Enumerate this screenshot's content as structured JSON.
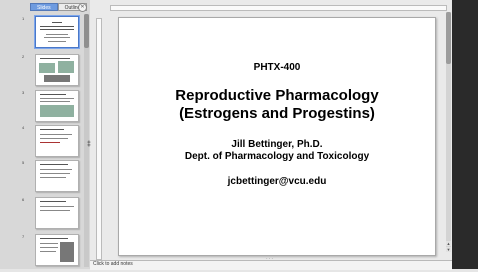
{
  "sidebar": {
    "tabs": [
      {
        "label": "Slides",
        "active": true
      },
      {
        "label": "Outline",
        "active": false
      }
    ],
    "close_icon": "close-icon",
    "slides": [
      {
        "number": "1",
        "selected": true
      },
      {
        "number": "2",
        "selected": false
      },
      {
        "number": "3",
        "selected": false
      },
      {
        "number": "4",
        "selected": false
      },
      {
        "number": "5",
        "selected": false
      },
      {
        "number": "6",
        "selected": false
      },
      {
        "number": "7",
        "selected": false
      }
    ]
  },
  "slide": {
    "course_code": "PHTX-400",
    "title_line1": "Reproductive Pharmacology",
    "title_line2": "(Estrogens and Progestins)",
    "presenter": "Jill Bettinger, Ph.D.",
    "department": "Dept. of Pharmacology and Toxicology",
    "email": "jcbettinger@vcu.edu"
  },
  "notes": {
    "placeholder": "Click to add notes"
  },
  "colors": {
    "active_tab": "#6e9be0",
    "selection_border": "#4a78c8",
    "app_background": "#e6e6e6",
    "dark_edge": "#2a2a2a"
  }
}
